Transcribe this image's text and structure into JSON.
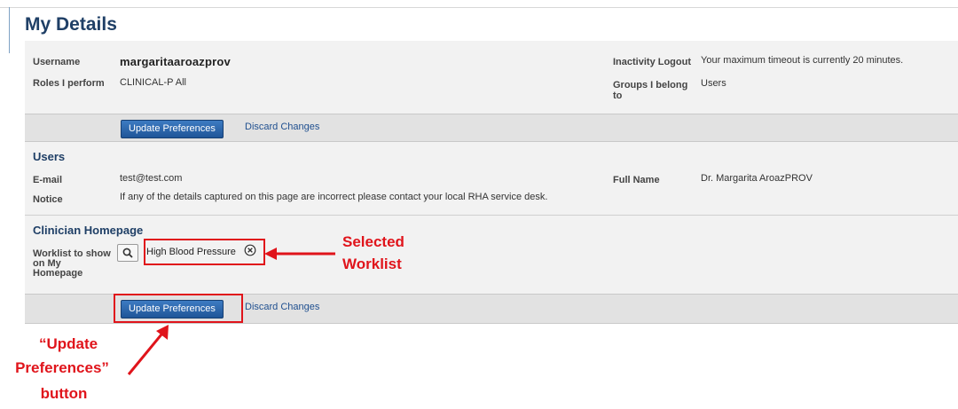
{
  "page": {
    "title": "My Details"
  },
  "account": {
    "username_label": "Username",
    "username_value": "margaritaaroazprov",
    "roles_label": "Roles I perform",
    "roles_value": "CLINICAL-P All",
    "inactivity_label": "Inactivity Logout",
    "inactivity_value": "Your maximum timeout is currently 20 minutes.",
    "groups_label_1": "Groups I belong",
    "groups_label_2": "to",
    "groups_value": "Users"
  },
  "actions_top": {
    "update_label": "Update Preferences",
    "discard_label": "Discard Changes"
  },
  "users": {
    "heading": "Users",
    "email_label": "E-mail",
    "email_value": "test@test.com",
    "notice_label": "Notice",
    "notice_value": "If any of the details captured on this page are incorrect please contact your local RHA service desk.",
    "fullname_label": "Full Name",
    "fullname_value": "Dr. Margarita AroazPROV"
  },
  "clinician": {
    "heading": "Clinician Homepage",
    "worklist_label_1": "Worklist to show",
    "worklist_label_2": "on My",
    "worklist_label_3": "Homepage",
    "selected_worklist": "High Blood Pressure",
    "search_icon": "search-icon",
    "remove_icon": "close-circle-icon"
  },
  "actions_bottom": {
    "update_label": "Update Preferences",
    "discard_label": "Discard Changes"
  },
  "annotations": {
    "selected_1": "Selected",
    "selected_2": "Worklist",
    "update_1": "“Update",
    "update_2": "Preferences”",
    "update_3": "button"
  },
  "colors": {
    "accent": "#1f5598",
    "title": "#1f3f66",
    "annotation": "#e0141b"
  }
}
